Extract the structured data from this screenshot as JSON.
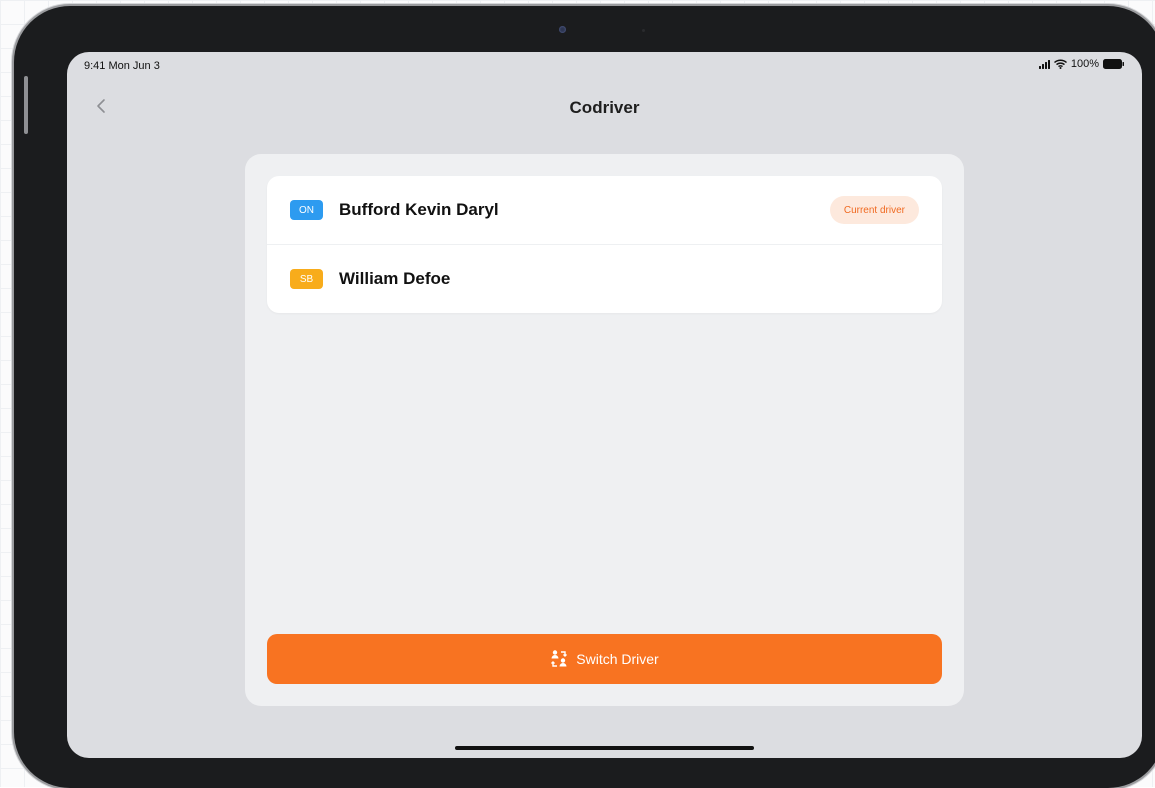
{
  "status_bar": {
    "time": "9:41 Mon Jun 3",
    "battery": "100%"
  },
  "nav": {
    "title": "Codriver",
    "back_icon": "chevron-left-icon"
  },
  "drivers": [
    {
      "status": "ON",
      "status_color": "#2d9bf0",
      "name": "Bufford Kevin Daryl",
      "badge": "Current driver"
    },
    {
      "status": "SB",
      "status_color": "#f8ac1b",
      "name": "William Defoe"
    }
  ],
  "actions": {
    "switch_label": "Switch Driver",
    "switch_icon": "swap-arrows-icon"
  },
  "colors": {
    "accent": "#f87321",
    "badge_bg": "#fde9dd",
    "badge_text": "#f06a21"
  }
}
